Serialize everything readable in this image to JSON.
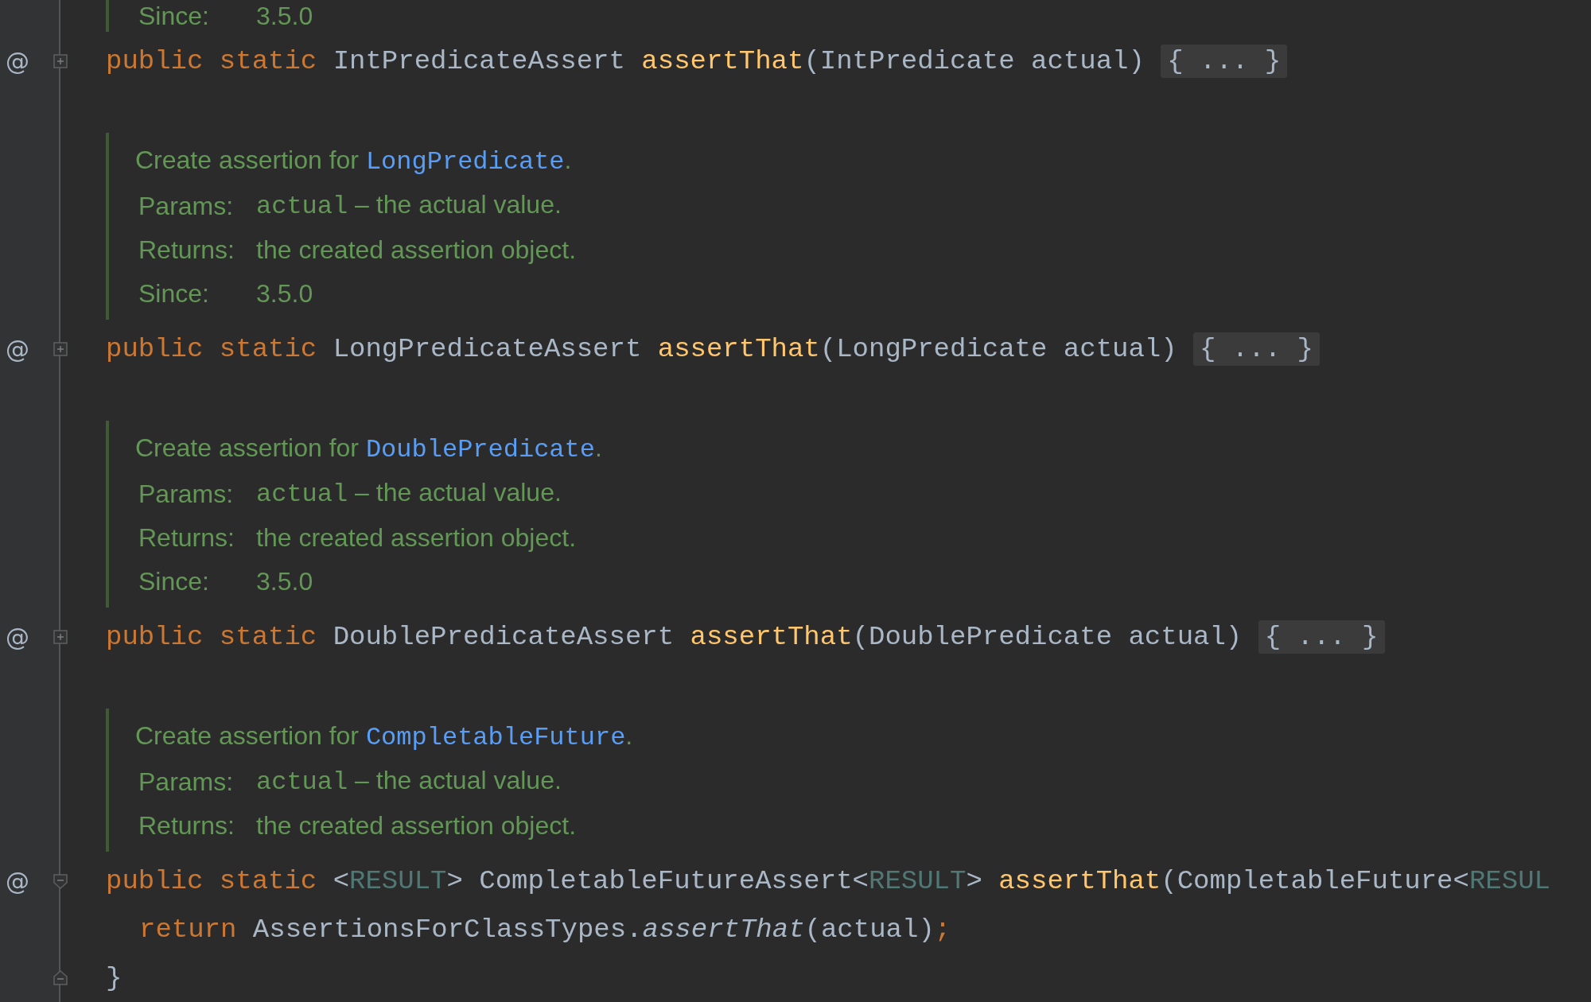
{
  "lines": [
    {
      "kind": "doc",
      "tags": [
        {
          "label": "Since:",
          "parts": [
            {
              "text": "3.5.0",
              "kind": "text"
            }
          ]
        }
      ]
    },
    {
      "kind": "code",
      "gutter": "@",
      "folded": true,
      "tokens": [
        {
          "text": "public static ",
          "kind": "keyword"
        },
        {
          "text": "IntPredicateAssert ",
          "kind": "plain"
        },
        {
          "text": "assertThat",
          "kind": "method"
        },
        {
          "text": "(IntPredicate actual) ",
          "kind": "plain"
        },
        {
          "text": "{ ... }",
          "kind": "folded"
        }
      ]
    },
    {
      "kind": "doc",
      "summary": [
        {
          "text": "Create assertion for ",
          "kind": "text"
        },
        {
          "text": "LongPredicate",
          "kind": "link"
        },
        {
          "text": ".",
          "kind": "text"
        }
      ],
      "tags": [
        {
          "label": "Params:",
          "parts": [
            {
              "text": "actual",
              "kind": "code"
            },
            {
              "text": " – the actual value.",
              "kind": "text"
            }
          ]
        },
        {
          "label": "Returns:",
          "parts": [
            {
              "text": "the created assertion object.",
              "kind": "text"
            }
          ]
        },
        {
          "label": "Since:",
          "parts": [
            {
              "text": "3.5.0",
              "kind": "text"
            }
          ]
        }
      ]
    },
    {
      "kind": "code",
      "gutter": "@",
      "folded": true,
      "tokens": [
        {
          "text": "public static ",
          "kind": "keyword"
        },
        {
          "text": "LongPredicateAssert ",
          "kind": "plain"
        },
        {
          "text": "assertThat",
          "kind": "method"
        },
        {
          "text": "(LongPredicate actual) ",
          "kind": "plain"
        },
        {
          "text": "{ ... }",
          "kind": "folded"
        }
      ]
    },
    {
      "kind": "doc",
      "summary": [
        {
          "text": "Create assertion for ",
          "kind": "text"
        },
        {
          "text": "DoublePredicate",
          "kind": "link"
        },
        {
          "text": ".",
          "kind": "text"
        }
      ],
      "tags": [
        {
          "label": "Params:",
          "parts": [
            {
              "text": "actual",
              "kind": "code"
            },
            {
              "text": " – the actual value.",
              "kind": "text"
            }
          ]
        },
        {
          "label": "Returns:",
          "parts": [
            {
              "text": "the created assertion object.",
              "kind": "text"
            }
          ]
        },
        {
          "label": "Since:",
          "parts": [
            {
              "text": "3.5.0",
              "kind": "text"
            }
          ]
        }
      ]
    },
    {
      "kind": "code",
      "gutter": "@",
      "folded": true,
      "tokens": [
        {
          "text": "public static ",
          "kind": "keyword"
        },
        {
          "text": "DoublePredicateAssert ",
          "kind": "plain"
        },
        {
          "text": "assertThat",
          "kind": "method"
        },
        {
          "text": "(DoublePredicate actual) ",
          "kind": "plain"
        },
        {
          "text": "{ ... }",
          "kind": "folded"
        }
      ]
    },
    {
      "kind": "doc",
      "summary": [
        {
          "text": "Create assertion for ",
          "kind": "text"
        },
        {
          "text": "CompletableFuture",
          "kind": "link"
        },
        {
          "text": ".",
          "kind": "text"
        }
      ],
      "tags": [
        {
          "label": "Params:",
          "parts": [
            {
              "text": "actual",
              "kind": "code"
            },
            {
              "text": " – the actual value.",
              "kind": "text"
            }
          ]
        },
        {
          "label": "Returns:",
          "parts": [
            {
              "text": "the created assertion object.",
              "kind": "text"
            }
          ]
        }
      ]
    },
    {
      "kind": "code",
      "gutter": "@",
      "folded": false,
      "tokens": [
        {
          "text": "public static ",
          "kind": "keyword"
        },
        {
          "text": "<",
          "kind": "plain"
        },
        {
          "text": "RESULT",
          "kind": "generic"
        },
        {
          "text": "> CompletableFutureAssert<",
          "kind": "plain"
        },
        {
          "text": "RESULT",
          "kind": "generic"
        },
        {
          "text": "> ",
          "kind": "plain"
        },
        {
          "text": "assertThat",
          "kind": "method"
        },
        {
          "text": "(CompletableFuture<",
          "kind": "plain"
        },
        {
          "text": "RESUL",
          "kind": "generic"
        }
      ]
    },
    {
      "kind": "code",
      "indent": true,
      "tokens": [
        {
          "text": "return ",
          "kind": "keyword"
        },
        {
          "text": "AssertionsForClassTypes.",
          "kind": "plain"
        },
        {
          "text": "assertThat",
          "kind": "italic"
        },
        {
          "text": "(actual)",
          "kind": "plain"
        },
        {
          "text": ";",
          "kind": "keyword"
        }
      ]
    },
    {
      "kind": "code",
      "fold_end": true,
      "tokens": [
        {
          "text": "}",
          "kind": "plain"
        }
      ]
    }
  ]
}
